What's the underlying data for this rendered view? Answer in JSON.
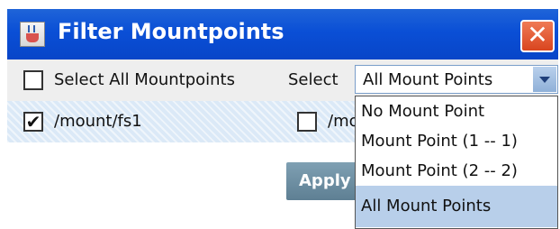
{
  "window": {
    "title": "Filter Mountpoints",
    "close_symbol": "✕"
  },
  "toolbar": {
    "select_all_label": "Select All Mountpoints",
    "select_label": "Select",
    "combo_value": "All Mount Points"
  },
  "rows": [
    {
      "checked": true,
      "check_symbol": "✔",
      "label": "/mount/fs1"
    },
    {
      "checked": false,
      "check_symbol": "",
      "label": "/mo"
    }
  ],
  "apply_label": "Apply",
  "dropdown": {
    "options": [
      {
        "label": "No Mount Point",
        "selected": false
      },
      {
        "label": "Mount Point  (1 -- 1)",
        "selected": false
      },
      {
        "label": "Mount Point  (2 -- 2)",
        "selected": false
      },
      {
        "label": "All Mount Points",
        "selected": true
      }
    ]
  },
  "colors": {
    "titlebar": "#0a4fd6",
    "row_highlight": "#dbe9f7",
    "selected_option": "#b8cfea",
    "close_button": "#d9451f"
  },
  "icons": {
    "app_icon": "java-cup-icon",
    "close_icon": "close-icon",
    "dropdown_arrow": "chevron-down-icon"
  }
}
